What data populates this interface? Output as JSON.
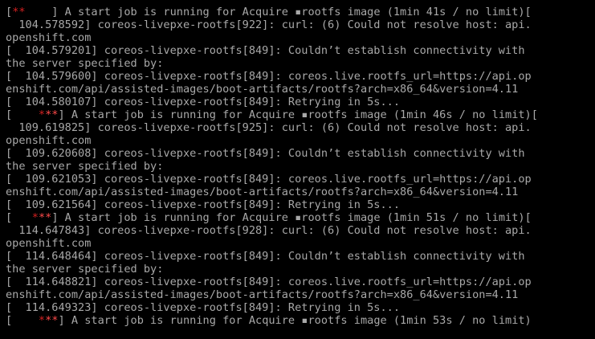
{
  "console": {
    "lines": [
      {
        "type": "job",
        "p1": "[",
        "r1": "**",
        "r2": "",
        "p2": "    ] A start job is running for Acquire ▪rootfs image (1min 41s / no limit)["
      },
      {
        "type": "text",
        "text": "  104.578592] coreos-livepxe-rootfs[922]: curl: (6) Could not resolve host: api."
      },
      {
        "type": "text",
        "text": "openshift.com"
      },
      {
        "type": "text",
        "text": "[  104.579201] coreos-livepxe-rootfs[849]: Couldn’t establish connectivity with"
      },
      {
        "type": "text",
        "text": "the server specified by:"
      },
      {
        "type": "text",
        "text": "[  104.579600] coreos-livepxe-rootfs[849]: coreos.live.rootfs_url=https://api.op"
      },
      {
        "type": "text",
        "text": "enshift.com/api/assisted-images/boot-artifacts/rootfs?arch=x86_64&version=4.11"
      },
      {
        "type": "text",
        "text": "[  104.580107] coreos-livepxe-rootfs[849]: Retrying in 5s..."
      },
      {
        "type": "job",
        "p1": "[    ",
        "r1": "*",
        "r2": "**",
        "p2": "] A start job is running for Acquire ▪rootfs image (1min 46s / no limit)["
      },
      {
        "type": "text",
        "text": "  109.619825] coreos-livepxe-rootfs[925]: curl: (6) Could not resolve host: api."
      },
      {
        "type": "text",
        "text": "openshift.com"
      },
      {
        "type": "text",
        "text": "[  109.620608] coreos-livepxe-rootfs[849]: Couldn’t establish connectivity with"
      },
      {
        "type": "text",
        "text": "the server specified by:"
      },
      {
        "type": "text",
        "text": "[  109.621053] coreos-livepxe-rootfs[849]: coreos.live.rootfs_url=https://api.op"
      },
      {
        "type": "text",
        "text": "enshift.com/api/assisted-images/boot-artifacts/rootfs?arch=x86_64&version=4.11"
      },
      {
        "type": "text",
        "text": "[  109.621564] coreos-livepxe-rootfs[849]: Retrying in 5s..."
      },
      {
        "type": "job",
        "p1": "[   ",
        "r1": "*",
        "r2": "**",
        "p2": "] A start job is running for Acquire ▪rootfs image (1min 51s / no limit)["
      },
      {
        "type": "text",
        "text": "  114.647843] coreos-livepxe-rootfs[928]: curl: (6) Could not resolve host: api."
      },
      {
        "type": "text",
        "text": "openshift.com"
      },
      {
        "type": "text",
        "text": "[  114.648464] coreos-livepxe-rootfs[849]: Couldn’t establish connectivity with"
      },
      {
        "type": "text",
        "text": "the server specified by:"
      },
      {
        "type": "text",
        "text": "[  114.648821] coreos-livepxe-rootfs[849]: coreos.live.rootfs_url=https://api.op"
      },
      {
        "type": "text",
        "text": "enshift.com/api/assisted-images/boot-artifacts/rootfs?arch=x86_64&version=4.11"
      },
      {
        "type": "text",
        "text": "[  114.649323] coreos-livepxe-rootfs[849]: Retrying in 5s..."
      },
      {
        "type": "job",
        "p1": "[    ",
        "r1": "*",
        "r2": "**",
        "p2": "] A start job is running for Acquire ▪rootfs image (1min 53s / no limit)"
      }
    ]
  },
  "colors": {
    "background": "#000000",
    "text": "#a8a8a8",
    "spinner_dim": "#d42020",
    "spinner_bright": "#ff4a4a"
  }
}
